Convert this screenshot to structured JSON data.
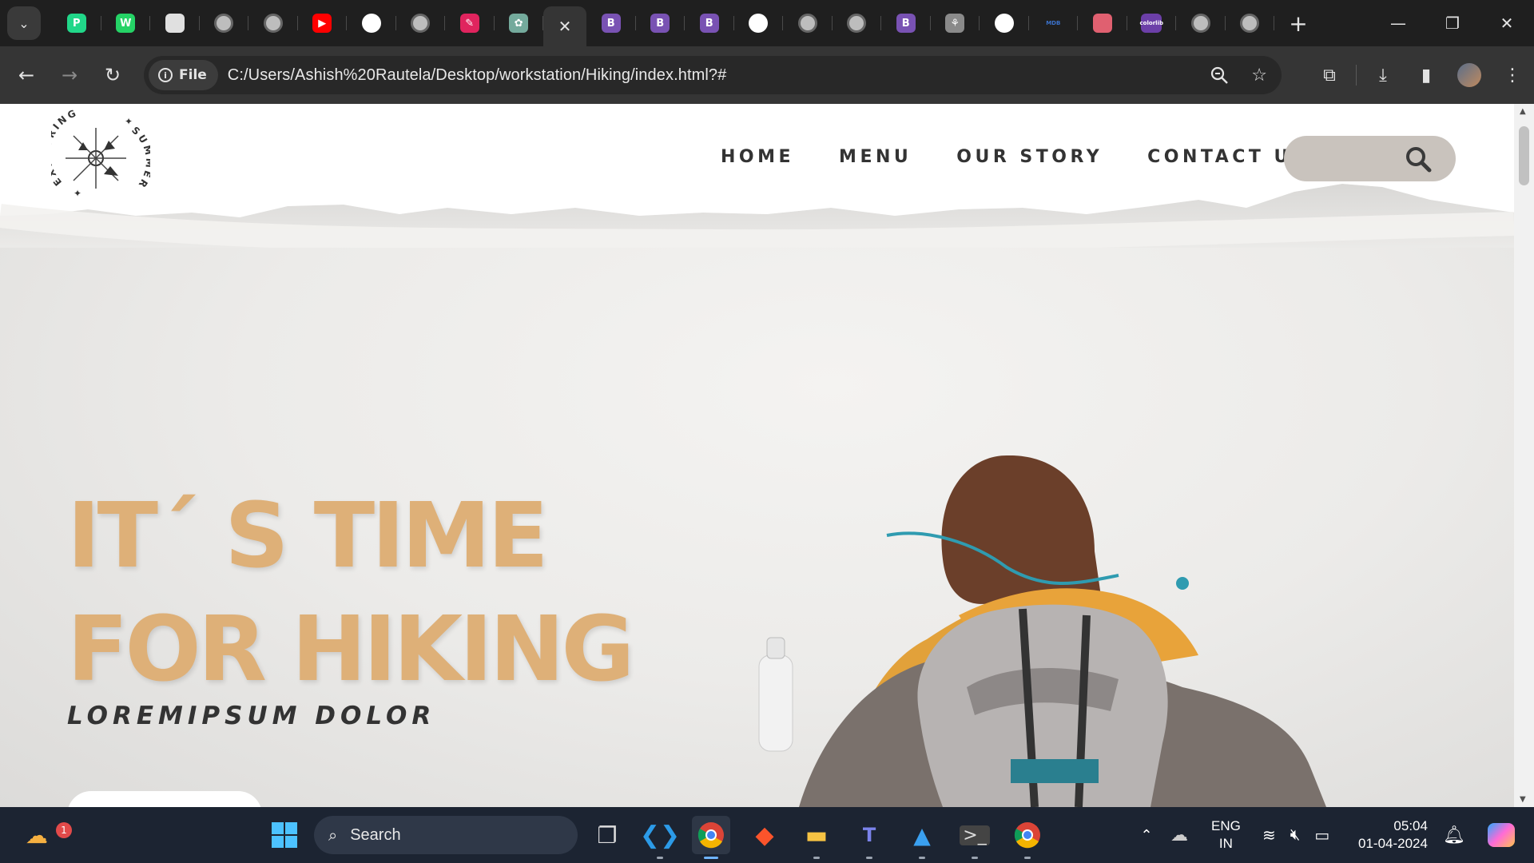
{
  "browser": {
    "tabs": [
      {
        "icon": "pycharm-icon",
        "color": "#21d789",
        "glyph": "P"
      },
      {
        "icon": "whatsapp-icon",
        "color": "#25d366",
        "glyph": "W"
      },
      {
        "icon": "site-icon",
        "color": "#e0e0e0",
        "glyph": ""
      },
      {
        "icon": "globe-icon",
        "color": "#bdbdbd",
        "glyph": ""
      },
      {
        "icon": "globe-icon",
        "color": "#bdbdbd",
        "glyph": ""
      },
      {
        "icon": "youtube-icon",
        "color": "#ff0000",
        "glyph": "▶"
      },
      {
        "icon": "github-icon",
        "color": "#ffffff",
        "glyph": ""
      },
      {
        "icon": "globe-icon",
        "color": "#bdbdbd",
        "glyph": ""
      },
      {
        "icon": "pen-icon",
        "color": "#e0245e",
        "glyph": "✎"
      },
      {
        "icon": "chatgpt-icon",
        "color": "#74aa9c",
        "glyph": "✿"
      },
      {
        "icon": "close-tab-icon",
        "color": "",
        "glyph": "✕",
        "active": true
      },
      {
        "icon": "bootstrap-icon",
        "color": "#7952b3",
        "glyph": "B"
      },
      {
        "icon": "bootstrap-icon",
        "color": "#7952b3",
        "glyph": "B"
      },
      {
        "icon": "bootstrap-icon",
        "color": "#7952b3",
        "glyph": "B"
      },
      {
        "icon": "github-icon",
        "color": "#ffffff",
        "glyph": ""
      },
      {
        "icon": "globe-icon",
        "color": "#bdbdbd",
        "glyph": ""
      },
      {
        "icon": "globe-icon",
        "color": "#bdbdbd",
        "glyph": ""
      },
      {
        "icon": "bootstrap-icon",
        "color": "#7952b3",
        "glyph": "B"
      },
      {
        "icon": "rabbit-icon",
        "color": "#8a8a8a",
        "glyph": "⚘"
      },
      {
        "icon": "github-icon",
        "color": "#ffffff",
        "glyph": ""
      },
      {
        "icon": "mdb-icon",
        "color": "#3b71ca",
        "glyph": "MDB"
      },
      {
        "icon": "app-icon",
        "color": "#e06070",
        "glyph": ""
      },
      {
        "icon": "colorlib-icon",
        "color": "#6c3fa8",
        "glyph": "colorlib"
      },
      {
        "icon": "globe-icon",
        "color": "#bdbdbd",
        "glyph": ""
      },
      {
        "icon": "chrome-icon",
        "color": "#bdbdbd",
        "glyph": ""
      }
    ],
    "address": {
      "chip": "File",
      "url": "C:/Users/Ashish%20Rautela/Desktop/workstation/Hiking/index.html?#"
    }
  },
  "page": {
    "logo_text_top": "EXPLORING",
    "logo_text_bottom": "SUMMER",
    "nav": [
      "HOME",
      "MENU",
      "OUR STORY",
      "CONTACT US"
    ],
    "hero_line1": "IT´ S TIME",
    "hero_line2": "FOR HIKING",
    "hero_sub": "LOREMIPSUM DOLOR",
    "accent_color": "#deb078"
  },
  "taskbar": {
    "weather_badge": "1",
    "search_label": "Search",
    "lang_line1": "ENG",
    "lang_line2": "IN",
    "time": "05:04",
    "date": "01-04-2024"
  }
}
